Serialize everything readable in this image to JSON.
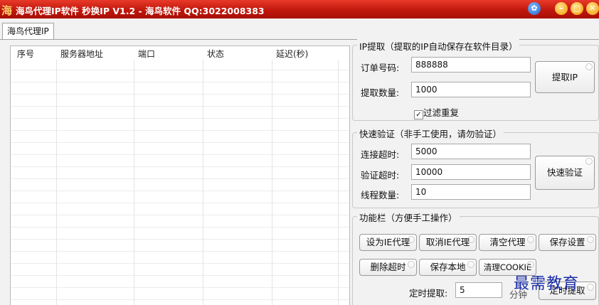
{
  "window": {
    "title": "海鸟代理IP软件 秒换IP V1.2 - 海鸟软件 QQ:3022008383",
    "icon_char": "海",
    "buttons": [
      "skin-icon",
      "minimize-icon",
      "maximize-icon",
      "close-icon"
    ]
  },
  "tab": {
    "label": "海鸟代理IP"
  },
  "table": {
    "columns": [
      "序号",
      "服务器地址",
      "端口",
      "状态",
      "延迟(秒)"
    ],
    "rows": []
  },
  "ip_extract": {
    "title": "IP提取（提取的IP自动保存在软件目录）",
    "order_label": "订单号码:",
    "order_value": "888888",
    "count_label": "提取数量:",
    "count_value": "1000",
    "button": "提取IP",
    "filter_label": "过滤重复",
    "filter_checked": true
  },
  "quick_verify": {
    "title": "快速验证（非手工使用，请勿验证）",
    "connect_label": "连接超时:",
    "connect_value": "5000",
    "verify_label": "验证超时:",
    "verify_value": "10000",
    "threads_label": "线程数量:",
    "threads_value": "10",
    "button": "快速验证"
  },
  "functions": {
    "title": "功能栏（方便手工操作）",
    "buttons_row1": [
      "设为IE代理",
      "取消IE代理",
      "清空代理",
      "保存设置"
    ],
    "buttons_row2": [
      "删除超时",
      "保存本地",
      "清理COOKIE"
    ],
    "timer_label": "定时提取:",
    "timer_value": "5",
    "timer_unit": "分钟",
    "timer_button": "定时提取"
  },
  "watermark": "最需教育",
  "colors": {
    "titlebar": "#c0170c",
    "title_text": "#ffffff",
    "watermark": "#1c2fa8"
  }
}
